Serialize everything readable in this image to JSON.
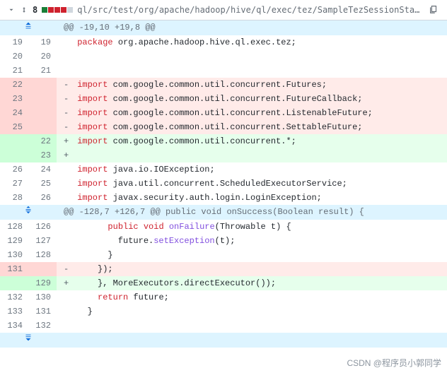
{
  "header": {
    "diff_count": "8",
    "file_path": "ql/src/test/org/apache/hadoop/hive/ql/exec/tez/SampleTezSessionState.java"
  },
  "hunk1": {
    "header": "@@ -19,10 +19,8 @@",
    "rows": [
      {
        "oln": "19",
        "nln": "19",
        "type": "ctx",
        "marker": "",
        "html": "<span class='kw'>package</span> org.apache.hadoop.hive.ql.exec.tez;"
      },
      {
        "oln": "20",
        "nln": "20",
        "type": "ctx",
        "marker": "",
        "html": ""
      },
      {
        "oln": "21",
        "nln": "21",
        "type": "ctx",
        "marker": "",
        "html": ""
      },
      {
        "oln": "22",
        "nln": "",
        "type": "del",
        "marker": "-",
        "html": "<span class='kw'>import</span> com.google.common.util.concurrent.Futures;"
      },
      {
        "oln": "23",
        "nln": "",
        "type": "del",
        "marker": "-",
        "html": "<span class='kw'>import</span> com.google.common.util.concurrent.FutureCallback;"
      },
      {
        "oln": "24",
        "nln": "",
        "type": "del",
        "marker": "-",
        "html": "<span class='kw'>import</span> com.google.common.util.concurrent.ListenableFuture;"
      },
      {
        "oln": "25",
        "nln": "",
        "type": "del",
        "marker": "-",
        "html": "<span class='kw'>import</span> com.google.common.util.concurrent.SettableFuture;"
      },
      {
        "oln": "",
        "nln": "22",
        "type": "add",
        "marker": "+",
        "html": "<span class='kw'>import</span> com.google.common.util.concurrent.*;"
      },
      {
        "oln": "",
        "nln": "23",
        "type": "add",
        "marker": "+",
        "html": ""
      },
      {
        "oln": "26",
        "nln": "24",
        "type": "ctx",
        "marker": "",
        "html": "<span class='kw'>import</span> java.io.IOException;"
      },
      {
        "oln": "27",
        "nln": "25",
        "type": "ctx",
        "marker": "",
        "html": "<span class='kw'>import</span> java.util.concurrent.ScheduledExecutorService;"
      },
      {
        "oln": "28",
        "nln": "26",
        "type": "ctx",
        "marker": "",
        "html": "<span class='kw'>import</span> javax.security.auth.login.LoginException;"
      }
    ]
  },
  "hunk2": {
    "header": "@@ -128,7 +126,7 @@ public void onSuccess(Boolean result) {",
    "rows": [
      {
        "oln": "128",
        "nln": "126",
        "type": "ctx",
        "marker": "",
        "html": "      <span class='kw'>public</span> <span class='kw'>void</span> <span class='fn'>onFailure</span>(Throwable t) {"
      },
      {
        "oln": "129",
        "nln": "127",
        "type": "ctx",
        "marker": "",
        "html": "        future.<span class='fn'>setException</span>(t);"
      },
      {
        "oln": "130",
        "nln": "128",
        "type": "ctx",
        "marker": "",
        "html": "      }"
      },
      {
        "oln": "131",
        "nln": "",
        "type": "del",
        "marker": "-",
        "html": "    });"
      },
      {
        "oln": "",
        "nln": "129",
        "type": "add",
        "marker": "+",
        "html": "    }, MoreExecutors.directExecutor());"
      },
      {
        "oln": "132",
        "nln": "130",
        "type": "ctx",
        "marker": "",
        "html": "    <span class='kw'>return</span> future;"
      },
      {
        "oln": "133",
        "nln": "131",
        "type": "ctx",
        "marker": "",
        "html": "  }"
      },
      {
        "oln": "134",
        "nln": "132",
        "type": "ctx",
        "marker": "",
        "html": ""
      }
    ]
  },
  "watermark": "CSDN @程序员小郭同学"
}
